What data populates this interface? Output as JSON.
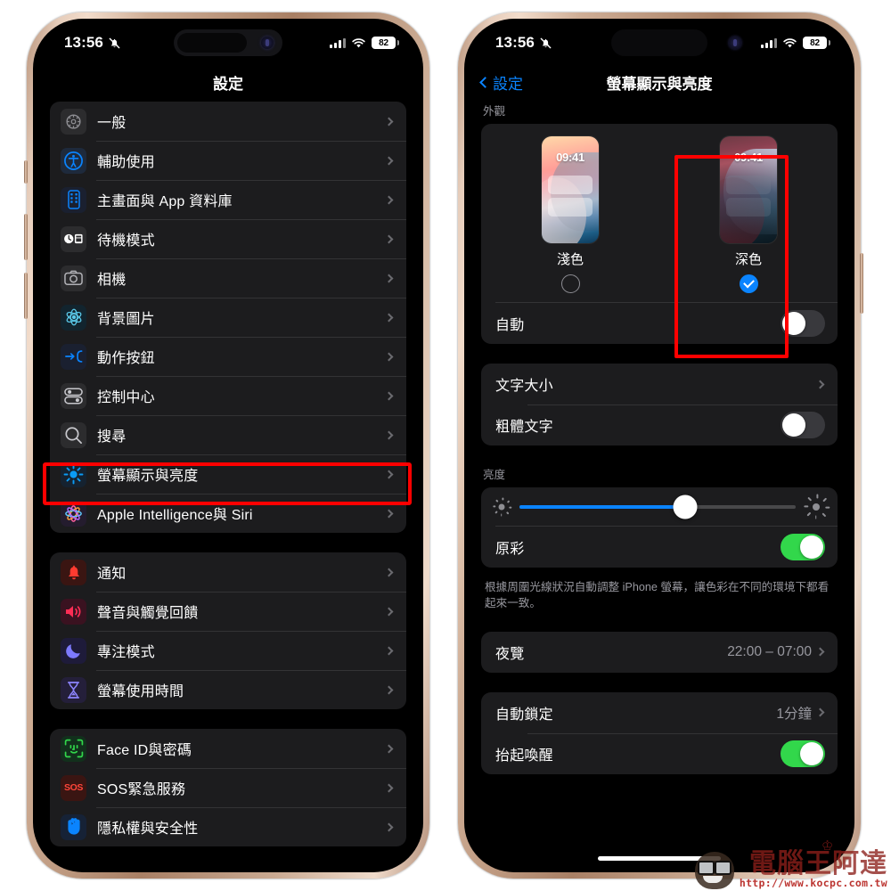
{
  "status_bar": {
    "time": "13:56",
    "silent_icon": "bell-slash-icon",
    "signal_icon": "cellular-signal-icon",
    "wifi_icon": "wifi-icon",
    "battery_level": "82"
  },
  "left_phone": {
    "nav_title": "設定",
    "groups": [
      {
        "id": "group-general",
        "rows": [
          {
            "label": "一般",
            "icon": "gear-icon",
            "icon_glyph": "⚙",
            "icon_bg": "#2c2c2e",
            "icon_color": "#8e8e93",
            "accessory": "chevron"
          },
          {
            "label": "輔助使用",
            "icon": "accessibility-icon",
            "icon_glyph": "◉",
            "icon_bg": "#1e2a3c",
            "icon_color": "#0a84ff",
            "accessory": "chevron"
          },
          {
            "label": "主畫面與 App 資料庫",
            "icon": "home-screen-icon",
            "icon_glyph": "▤",
            "icon_bg": "#1a2030",
            "icon_color": "#0a84ff",
            "accessory": "chevron"
          },
          {
            "label": "待機模式",
            "icon": "standby-icon",
            "icon_glyph": "◐▤",
            "icon_bg": "#2c2c2e",
            "icon_color": "#e5e5ea",
            "accessory": "chevron"
          },
          {
            "label": "相機",
            "icon": "camera-icon",
            "icon_glyph": "▣",
            "icon_bg": "#2c2c2e",
            "icon_color": "#b0b0b5",
            "accessory": "chevron"
          },
          {
            "label": "背景圖片",
            "icon": "wallpaper-icon",
            "icon_glyph": "❋",
            "icon_bg": "#12242e",
            "icon_color": "#5ac8e8",
            "accessory": "chevron"
          },
          {
            "label": "動作按鈕",
            "icon": "action-button-icon",
            "icon_glyph": "→",
            "icon_bg": "#1a2030",
            "icon_color": "#0a84ff",
            "accessory": "chevron"
          },
          {
            "label": "控制中心",
            "icon": "control-center-icon",
            "icon_glyph": "⊟",
            "icon_bg": "#2c2c2e",
            "icon_color": "#c7c7cc",
            "accessory": "chevron"
          },
          {
            "label": "搜尋",
            "icon": "search-icon",
            "icon_glyph": "⌕",
            "icon_bg": "#2c2c2e",
            "icon_color": "#c7c7cc",
            "accessory": "chevron"
          },
          {
            "label": "螢幕顯示與亮度",
            "icon": "brightness-icon",
            "icon_glyph": "☀",
            "icon_bg": "#152230",
            "icon_color": "#0a9bf5",
            "accessory": "chevron",
            "highlighted": true
          },
          {
            "label": "Apple Intelligence與 Siri",
            "icon": "apple-intelligence-icon",
            "icon_glyph": "✺",
            "icon_bg": "#241c2e",
            "icon_color": "#ff6fae",
            "accessory": "chevron"
          }
        ]
      },
      {
        "id": "group-notifications",
        "rows": [
          {
            "label": "通知",
            "icon": "bell-icon",
            "icon_glyph": "🔔",
            "icon_bg": "#3a1512",
            "icon_color": "#ff3b30",
            "accessory": "chevron"
          },
          {
            "label": "聲音與觸覺回饋",
            "icon": "sound-haptics-icon",
            "icon_glyph": "🔊",
            "icon_bg": "#3a1220",
            "icon_color": "#ff2d55",
            "accessory": "chevron"
          },
          {
            "label": "專注模式",
            "icon": "focus-moon-icon",
            "icon_glyph": "☾",
            "icon_bg": "#1e1b3a",
            "icon_color": "#7d7aff",
            "accessory": "chevron"
          },
          {
            "label": "螢幕使用時間",
            "icon": "screen-time-icon",
            "icon_glyph": "⧗",
            "icon_bg": "#241f3a",
            "icon_color": "#8e86ff",
            "accessory": "chevron"
          }
        ]
      },
      {
        "id": "group-security",
        "rows": [
          {
            "label": "Face ID與密碼",
            "icon": "face-id-icon",
            "icon_glyph": "☺",
            "icon_bg": "#12301c",
            "icon_color": "#32d74b",
            "accessory": "chevron"
          },
          {
            "label": "SOS緊急服務",
            "icon": "sos-icon",
            "icon_glyph": "SOS",
            "icon_bg": "#3a1512",
            "icon_color": "#ff453a",
            "accessory": "chevron"
          },
          {
            "label": "隱私權與安全性",
            "icon": "privacy-hand-icon",
            "icon_glyph": "✋",
            "icon_bg": "#162236",
            "icon_color": "#0a84ff",
            "accessory": "chevron"
          }
        ]
      }
    ]
  },
  "right_phone": {
    "nav_back_label": "設定",
    "nav_title": "螢幕顯示與亮度",
    "appearance": {
      "header": "外觀",
      "options": [
        {
          "label": "淺色",
          "selected": false,
          "clock": "09:41",
          "id": "appearance-light"
        },
        {
          "label": "深色",
          "selected": true,
          "clock": "09:41",
          "id": "appearance-dark",
          "highlighted": true
        }
      ],
      "auto_row": {
        "label": "自動",
        "toggle_on": false
      }
    },
    "text_group": [
      {
        "label": "文字大小",
        "accessory": "chevron"
      },
      {
        "label": "粗體文字",
        "accessory": "toggle",
        "toggle_on": false
      }
    ],
    "brightness": {
      "header": "亮度",
      "slider_percent": 60,
      "slider_icon_left": "brightness-low-icon",
      "slider_icon_right": "brightness-high-icon",
      "true_tone": {
        "label": "原彩",
        "toggle_on": true
      },
      "footnote": "根據周圍光線狀況自動調整 iPhone 螢幕，讓色彩在不同的環境下都看起來一致。"
    },
    "night_shift": {
      "label": "夜覽",
      "value": "22:00 – 07:00",
      "accessory": "chevron"
    },
    "lock_group": [
      {
        "label": "自動鎖定",
        "value": "1分鐘",
        "accessory": "chevron"
      },
      {
        "label": "抬起喚醒",
        "accessory": "toggle",
        "toggle_on": true
      }
    ]
  },
  "watermark": {
    "text": "電腦王阿達",
    "url": "http://www.kocpc.com.tw"
  },
  "colors": {
    "accent_blue": "#0a84ff",
    "toggle_green": "#32d74b",
    "highlight_red": "#ff0000",
    "group_bg": "#1c1c1e",
    "screen_bg": "#000000",
    "secondary_text": "#98989f"
  }
}
